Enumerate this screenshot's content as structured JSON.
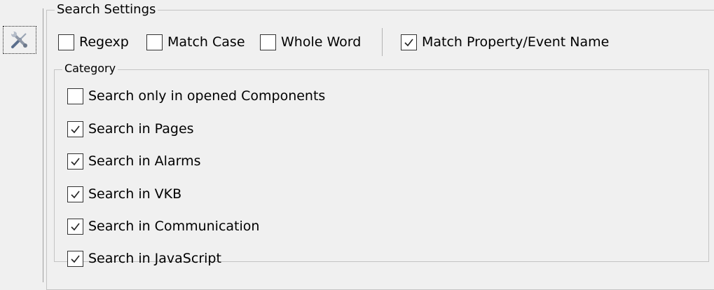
{
  "tool_button": {
    "icon": "tools-icon"
  },
  "search_settings": {
    "title": "Search Settings",
    "options": [
      {
        "label": "Regexp",
        "checked": false
      },
      {
        "label": "Match Case",
        "checked": false
      },
      {
        "label": "Whole Word",
        "checked": false
      }
    ],
    "match_property": {
      "label": "Match Property/Event Name",
      "checked": true
    }
  },
  "category": {
    "title": "Category",
    "items": [
      {
        "label": "Search only in opened Components",
        "checked": false
      },
      {
        "label": "Search in Pages",
        "checked": true
      },
      {
        "label": "Search in Alarms",
        "checked": true
      },
      {
        "label": "Search in VKB",
        "checked": true
      },
      {
        "label": "Search in Communication",
        "checked": true
      },
      {
        "label": "Search in JavaScript",
        "checked": true
      }
    ]
  }
}
